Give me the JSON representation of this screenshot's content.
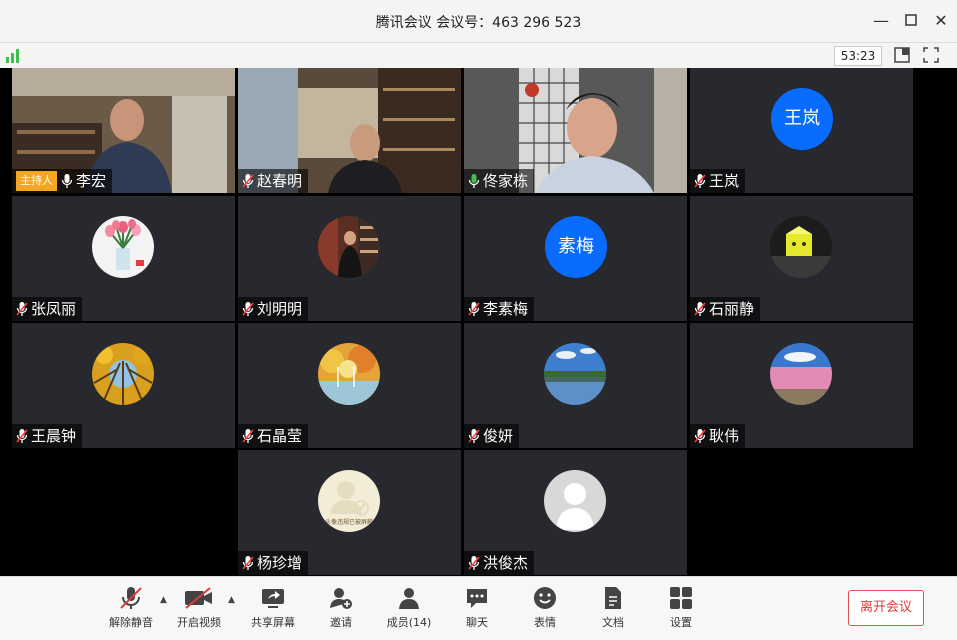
{
  "window": {
    "title": "腾讯会议  会议号：463 296 523"
  },
  "status": {
    "timer": "53:23"
  },
  "participants": [
    {
      "name": "李宏",
      "host_label": "主持人",
      "mic": "on",
      "video": true
    },
    {
      "name": "赵春明",
      "mic": "muted",
      "video": true
    },
    {
      "name": "佟家栋",
      "mic": "speaking",
      "video": true
    },
    {
      "name": "王岚",
      "avatar_text": "王岚",
      "mic": "muted"
    },
    {
      "name": "张凤丽",
      "mic": "muted",
      "avatar_icon": "tulip-flowers-icon"
    },
    {
      "name": "刘明明",
      "mic": "muted",
      "avatar_icon": "portrait-photo-icon"
    },
    {
      "name": "李素梅",
      "avatar_text": "素梅",
      "mic": "muted"
    },
    {
      "name": "石丽静",
      "mic": "muted",
      "avatar_icon": "yellow-box-icon"
    },
    {
      "name": "王晨钟",
      "mic": "muted",
      "avatar_icon": "autumn-trees-icon"
    },
    {
      "name": "石晶莹",
      "mic": "muted",
      "avatar_icon": "autumn-landscape-icon"
    },
    {
      "name": "俊妍",
      "mic": "muted",
      "avatar_icon": "lake-landscape-icon"
    },
    {
      "name": "耿伟",
      "mic": "muted",
      "avatar_icon": "pink-lake-icon"
    },
    {
      "name": "杨珍增",
      "mic": "muted",
      "avatar_icon": "placeholder-person-icon",
      "avatar_caption": "头像违规已被屏蔽"
    },
    {
      "name": "洪俊杰",
      "mic": "muted",
      "avatar_icon": "default-person-icon"
    }
  ],
  "toolbar": {
    "unmute": "解除静音",
    "start_video": "开启视频",
    "share_screen": "共享屏幕",
    "invite": "邀请",
    "members": "成员(14)",
    "chat": "聊天",
    "reactions": "表情",
    "docs": "文档",
    "settings": "设置",
    "leave": "离开会议"
  },
  "colors": {
    "accent_blue": "#0a6cff",
    "host_badge": "#f5a623",
    "leave_red": "#e03a3a",
    "signal_green": "#3fbf4d"
  }
}
